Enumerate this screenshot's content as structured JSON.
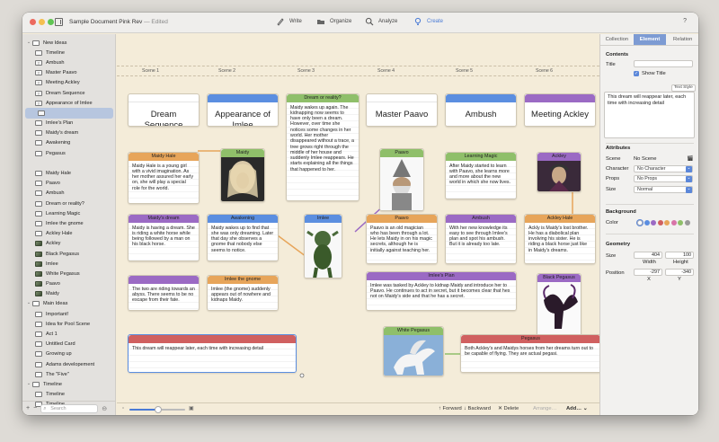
{
  "window": {
    "title": "Sample Document Pink Rev",
    "edited": "— Edited",
    "help": "?"
  },
  "toolbar": {
    "write": "Write",
    "organize": "Organize",
    "analyze": "Analyze",
    "create": "Create",
    "active": "create",
    "active_color": "#4a7bd6"
  },
  "sidebar": {
    "items": [
      {
        "label": "New Ideas",
        "icon": "folder",
        "level": 0,
        "disclosure": true
      },
      {
        "label": "Timeline",
        "icon": "doc",
        "level": 1
      },
      {
        "label": "Ambush",
        "icon": "text",
        "level": 1
      },
      {
        "label": "Master Paavo",
        "icon": "text",
        "level": 1
      },
      {
        "label": "Meeting Ackley",
        "icon": "text",
        "level": 1
      },
      {
        "label": "Dream Sequence",
        "icon": "text",
        "level": 1
      },
      {
        "label": "Appearance of Imlee",
        "icon": "text",
        "level": 1
      },
      {
        "label": "",
        "icon": "doc",
        "level": 1,
        "selected": true
      },
      {
        "label": "Imlee's Plan",
        "icon": "doc",
        "level": 1
      },
      {
        "label": "Maidy's dream",
        "icon": "doc",
        "level": 1
      },
      {
        "label": "Awakening",
        "icon": "doc",
        "level": 1
      },
      {
        "label": "Pegasus",
        "icon": "doc",
        "level": 1
      },
      {
        "label": "",
        "icon": "none",
        "level": 1
      },
      {
        "label": "Maidy Hale",
        "icon": "doc",
        "level": 1
      },
      {
        "label": "Paavo",
        "icon": "doc",
        "level": 1
      },
      {
        "label": "Ambush",
        "icon": "doc",
        "level": 1
      },
      {
        "label": "Dream or reality?",
        "icon": "doc",
        "level": 1
      },
      {
        "label": "Learning Magic",
        "icon": "doc",
        "level": 1
      },
      {
        "label": "Imlee the gnome",
        "icon": "doc",
        "level": 1
      },
      {
        "label": "Ackley Hale",
        "icon": "doc",
        "level": 1
      },
      {
        "label": "Ackley",
        "icon": "image",
        "level": 1
      },
      {
        "label": "Black Pegasus",
        "icon": "image",
        "level": 1
      },
      {
        "label": "Imlee",
        "icon": "image",
        "level": 1
      },
      {
        "label": "White Pegasus",
        "icon": "image",
        "level": 1
      },
      {
        "label": "Paavo",
        "icon": "image",
        "level": 1
      },
      {
        "label": "Maidy",
        "icon": "image",
        "level": 1
      },
      {
        "label": "Main Ideas",
        "icon": "folder",
        "level": 0,
        "disclosure": true
      },
      {
        "label": "Important!",
        "icon": "doc",
        "level": 1
      },
      {
        "label": "Idea for Pool Scene",
        "icon": "doc",
        "level": 1
      },
      {
        "label": "Act 1",
        "icon": "doc",
        "level": 1
      },
      {
        "label": "Untitled Card",
        "icon": "doc",
        "level": 1
      },
      {
        "label": "Growing up",
        "icon": "doc",
        "level": 1
      },
      {
        "label": "Adams developement",
        "icon": "doc",
        "level": 1
      },
      {
        "label": "The \"Five\"",
        "icon": "doc",
        "level": 1
      },
      {
        "label": "Timeline",
        "icon": "folder",
        "level": 0,
        "disclosure": true
      },
      {
        "label": "Timeline",
        "icon": "doc",
        "level": 1
      },
      {
        "label": "Timeline",
        "icon": "doc",
        "level": 1
      }
    ],
    "search_placeholder": "Search",
    "add": "+",
    "remove": "−"
  },
  "scenes": [
    "Scene 1",
    "Scene 2",
    "Scene 3",
    "Scene 4",
    "Scene 5",
    "Scene 6"
  ],
  "cards": [
    {
      "id": "dream-sequence",
      "big": true,
      "title": "",
      "body": "Dream Sequence",
      "color": "#ffffff"
    },
    {
      "id": "appearance-of-imlee",
      "big": true,
      "title": "",
      "body": "Appearance of Imlee",
      "color": "#5b8ee0"
    },
    {
      "id": "dream-or-reality",
      "title": "Dream or reality?",
      "body": "Maidy wakes up again. The kidnapping now seems to have only been a dream. However, over time she notices some changes in her world. Her mother disappeared without a trace, a tree grows right through the middle of her house and suddenly Imlee reappears. He starts explaining all the things that happened to her.",
      "color": "#8fbf6a"
    },
    {
      "id": "master-paavo",
      "big": true,
      "title": "",
      "body": "Master Paavo",
      "color": "#ffffff"
    },
    {
      "id": "ambush-big",
      "big": true,
      "title": "",
      "body": "Ambush",
      "color": "#5b8ee0"
    },
    {
      "id": "meeting-ackley",
      "big": true,
      "title": "",
      "body": "Meeting Ackley",
      "color": "#9b6ac4"
    },
    {
      "id": "maidy-hale",
      "title": "Maidy Hale",
      "body": "Maidy Hale is a young girl with a vivid imagination. As her mother assured her early on, she will play a special role for the world.",
      "color": "#e7a55a"
    },
    {
      "id": "maidy-img",
      "image": true,
      "title": "Maidy",
      "color": "#8fbf6a"
    },
    {
      "id": "paavo-img",
      "image": true,
      "title": "Paavo",
      "color": "#8fbf6a"
    },
    {
      "id": "learning-magic",
      "title": "Learning Magic",
      "body": "After Maidy started to learn with Paavo, she learns more and more about the new world in which she now lives.",
      "color": "#8fbf6a"
    },
    {
      "id": "ackley-img",
      "image": true,
      "title": "Ackley",
      "color": "#9b6ac4"
    },
    {
      "id": "maidys-dream",
      "title": "Maidy's dream",
      "body": "Maidy is having a dream. She is riding a white horse while being followed by a man on his black horse.",
      "color": "#9b6ac4"
    },
    {
      "id": "awakening",
      "title": "Awakening",
      "body": "Maidy wakes up to find that she was only dreaming. Later that day she observes a gnome that nobody else seems to notice.",
      "color": "#5b8ee0"
    },
    {
      "id": "imlee-img",
      "image": true,
      "title": "Imlee",
      "color": "#5b8ee0"
    },
    {
      "id": "paavo",
      "title": "Paavo",
      "body": "Paavo is an old magician who has been through a lot. He lets Maidy in on his magic secrets, although he is initially against teaching her.",
      "color": "#e7a55a"
    },
    {
      "id": "ambush",
      "title": "Ambush",
      "body": "With her new knowledge its easy to see through Imlee's plan and spot his ambush. But it is already too late.",
      "color": "#9b6ac4"
    },
    {
      "id": "ackley-hale",
      "title": "Ackley Hale",
      "body": "Ackly is Maidy's lost brother. He has a diabolical plan involving his sister. He is riding a black horse just like in Maidy's dreams.",
      "color": "#e7a55a"
    },
    {
      "id": "riding-card",
      "title": "",
      "body": "The two are riding towards an abyss. There seems to be no escape from their fate.",
      "color": "#9b6ac4"
    },
    {
      "id": "imlee-gnome",
      "title": "Imlee the gnome",
      "body": "Imlee (the gnome) suddenly appears out of nowhere and kidnaps Maidy.",
      "color": "#e7a55a"
    },
    {
      "id": "imlees-plan",
      "title": "Imlee's Plan",
      "body": "Imlee was tasked by Ackley to kidnap Maidy and introduce her to Paavo. He continues to act in secret, but it becomes clear that hes not on Maidy's side and that he has a secret.",
      "color": "#9b6ac4"
    },
    {
      "id": "black-pegasus-img",
      "image": true,
      "title": "Black Pegasus",
      "color": "#9b6ac4"
    },
    {
      "id": "reappear-card",
      "title": "",
      "body": "This dream will reappear later, each time with increasing detail",
      "color": "#d06060"
    },
    {
      "id": "white-pegasus-img",
      "image": true,
      "title": "White Pegasus",
      "color": "#8fbf6a"
    },
    {
      "id": "pegasus",
      "title": "Pegasus",
      "body": "Both Ackley's and Maidys horses from her dreams turn out to be capable of flying. They are actual pegasi.",
      "color": "#d06060"
    }
  ],
  "canvas_bottom": {
    "forward": "↑ Forward",
    "backward": "↓ Backward",
    "delete": "✕ Delete",
    "arrange": "Arrange…",
    "add": "Add…"
  },
  "inspector": {
    "tabs": [
      "Collection",
      "Element",
      "Relation"
    ],
    "active_tab": "Element",
    "contents_heading": "Contents",
    "title_label": "Title",
    "title_value": "",
    "show_title_label": "Show Title",
    "show_title_checked": true,
    "text_style_button": "Text Style",
    "text_value": "This dream will reappear later, each time with increasing detail",
    "attributes_heading": "Attributes",
    "scene_label": "Scene",
    "scene_value": "No Scene",
    "character_label": "Character",
    "character_value": "No Character",
    "props_label": "Props",
    "props_value": "No Props",
    "size_label": "Size",
    "size_value": "Normal",
    "background_heading": "Background",
    "color_label": "Color",
    "swatches": [
      "#ffffff",
      "#5b8ee0",
      "#9b6ac4",
      "#d06060",
      "#e7a55a",
      "#d874a8",
      "#8fbf6a",
      "#9a9a9a"
    ],
    "geometry_heading": "Geometry",
    "size_geo_label": "Size",
    "width_value": "404",
    "height_value": "100",
    "width_label": "Width",
    "height_label": "Height",
    "position_label": "Position",
    "x_value": "-297",
    "y_value": "-340",
    "x_label": "X",
    "y_label": "Y"
  }
}
